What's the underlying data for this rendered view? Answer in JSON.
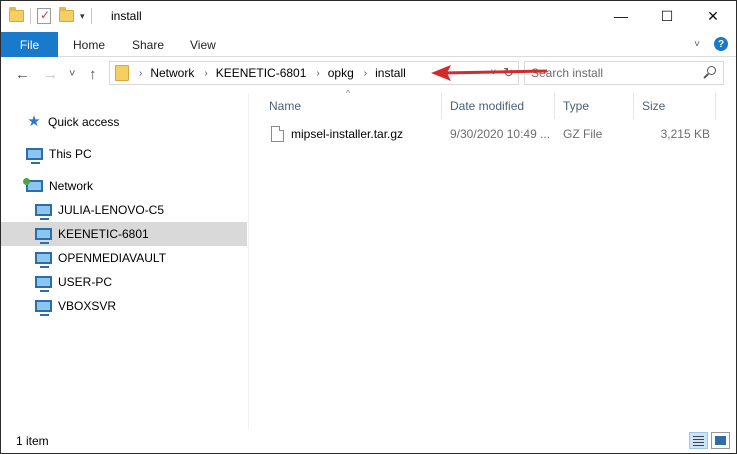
{
  "window": {
    "title": "install",
    "controls": {
      "minimize": "—",
      "maximize": "☐",
      "close": "✕"
    }
  },
  "ribbon": {
    "tabs": [
      "File",
      "Home",
      "Share",
      "View"
    ],
    "expand_icon": "chevron-down-icon",
    "help_label": "?"
  },
  "navigation": {
    "back": "←",
    "forward": "→",
    "recent": "˅",
    "up": "↑"
  },
  "address": {
    "breadcrumbs": [
      "Network",
      "KEENETIC-6801",
      "opkg",
      "install"
    ],
    "separator": "›"
  },
  "search": {
    "placeholder": "Search install"
  },
  "annotation": {
    "arrow_color": "#d22b2b"
  },
  "nav_pane": {
    "items": [
      {
        "label": "Quick access",
        "icon": "star-icon"
      },
      {
        "label": "This PC",
        "icon": "pc-icon"
      },
      {
        "label": "Network",
        "icon": "network-icon"
      },
      {
        "label": "JULIA-LENOVO-C5",
        "icon": "computer-icon"
      },
      {
        "label": "KEENETIC-6801",
        "icon": "computer-icon",
        "selected": true
      },
      {
        "label": "OPENMEDIAVAULT",
        "icon": "computer-icon"
      },
      {
        "label": "USER-PC",
        "icon": "computer-icon"
      },
      {
        "label": "VBOXSVR",
        "icon": "computer-icon"
      }
    ]
  },
  "file_list": {
    "columns": [
      "Name",
      "Date modified",
      "Type",
      "Size"
    ],
    "sort_indicator": "^",
    "rows": [
      {
        "name": "mipsel-installer.tar.gz",
        "date": "9/30/2020 10:49 ...",
        "type": "GZ File",
        "size": "3,215 KB"
      }
    ]
  },
  "status": {
    "item_count": "1 item"
  }
}
